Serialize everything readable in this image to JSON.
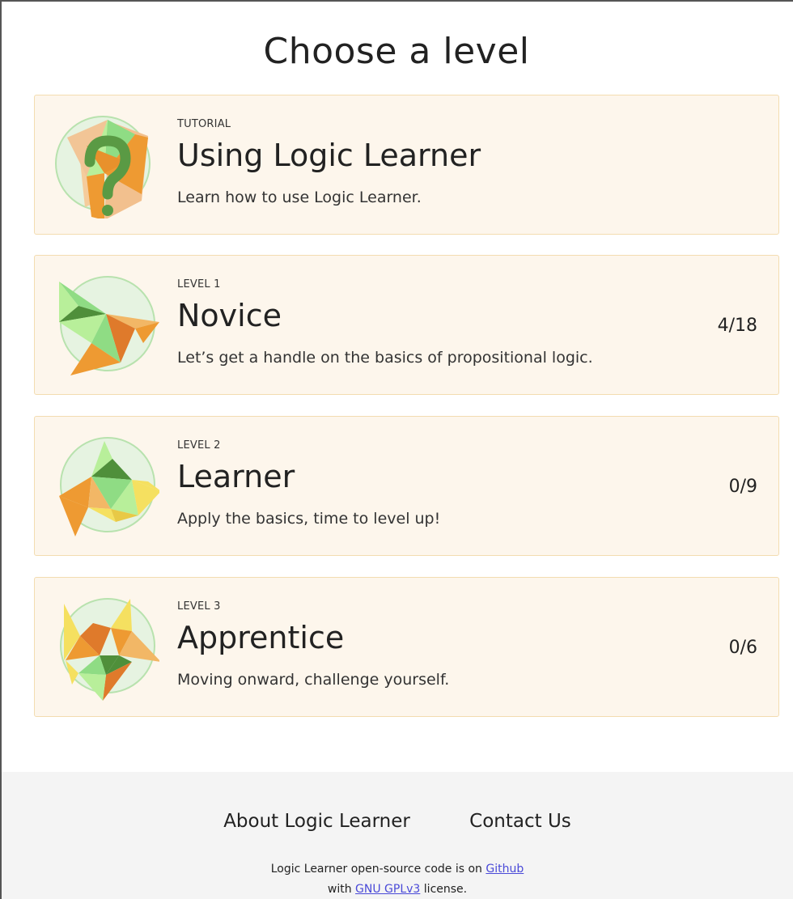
{
  "page": {
    "title": "Choose a level"
  },
  "levels": [
    {
      "tag": "TUTORIAL",
      "title": "Using Logic Learner",
      "description": "Learn how to use Logic Learner.",
      "progress": "",
      "icon": "question-mark-icon"
    },
    {
      "tag": "LEVEL 1",
      "title": "Novice",
      "description": "Let’s get a handle on the basics of propositional logic.",
      "progress": "4/18",
      "icon": "novice-polygon-icon"
    },
    {
      "tag": "LEVEL 2",
      "title": "Learner",
      "description": "Apply the basics, time to level up!",
      "progress": "0/9",
      "icon": "learner-polygon-icon"
    },
    {
      "tag": "LEVEL 3",
      "title": "Apprentice",
      "description": "Moving onward, challenge yourself.",
      "progress": "0/6",
      "icon": "apprentice-polygon-icon"
    }
  ],
  "footer": {
    "about_label": "About Logic Learner",
    "contact_label": "Contact Us",
    "note_prefix": "Logic Learner open-source code is on ",
    "github_label": "Github",
    "note_mid": "with ",
    "license_label": "GNU GPLv3",
    "note_suffix": " license."
  },
  "colors": {
    "card_bg": "#fdf6ec",
    "card_border": "#f3dcb0",
    "link": "#4a4ad8",
    "footer_bg": "#f4f4f4"
  }
}
